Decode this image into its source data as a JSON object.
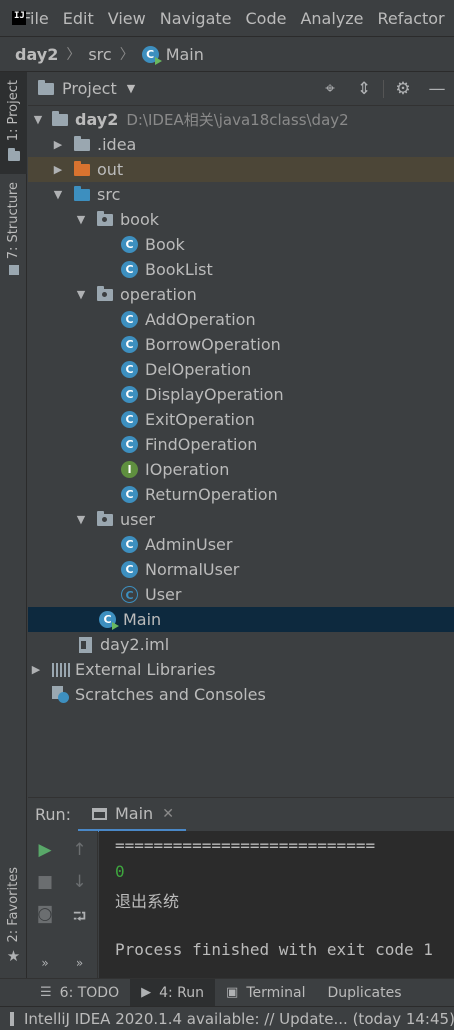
{
  "menu": [
    "File",
    "Edit",
    "View",
    "Navigate",
    "Code",
    "Analyze",
    "Refactor"
  ],
  "breadcrumb": {
    "project": "day2",
    "folder": "src",
    "file": "Main"
  },
  "left_tabs": {
    "project": "1: Project",
    "structure": "7: Structure",
    "favorites": "2: Favorites"
  },
  "panel": {
    "title": "Project"
  },
  "tree": {
    "root": {
      "name": "day2",
      "path": "D:\\IDEA相关\\java18class\\day2"
    },
    "idea": ".idea",
    "out": "out",
    "src": "src",
    "book": {
      "name": "book",
      "items": [
        "Book",
        "BookList"
      ]
    },
    "operation": {
      "name": "operation",
      "items": [
        "AddOperation",
        "BorrowOperation",
        "DelOperation",
        "DisplayOperation",
        "ExitOperation",
        "FindOperation",
        "IOperation",
        "ReturnOperation"
      ]
    },
    "user": {
      "name": "user",
      "items": [
        "AdminUser",
        "NormalUser",
        "User"
      ]
    },
    "main": "Main",
    "iml": "day2.iml",
    "libs": "External Libraries",
    "scratches": "Scratches and Consoles"
  },
  "run": {
    "label": "Run:",
    "tab": "Main",
    "console": [
      "===========================",
      "0",
      "退出系统",
      "",
      "Process finished with exit code 1"
    ]
  },
  "bottom_tabs": [
    "6: TODO",
    "4: Run",
    "Terminal",
    "Duplicates"
  ],
  "status": "IntelliJ IDEA 2020.1.4 available: // Update... (today 14:45)",
  "colors": {
    "selection": "#0d293e",
    "out_highlight": "#4c4637",
    "class_icon": "#3d8fbf",
    "run_green": "#59a869"
  }
}
